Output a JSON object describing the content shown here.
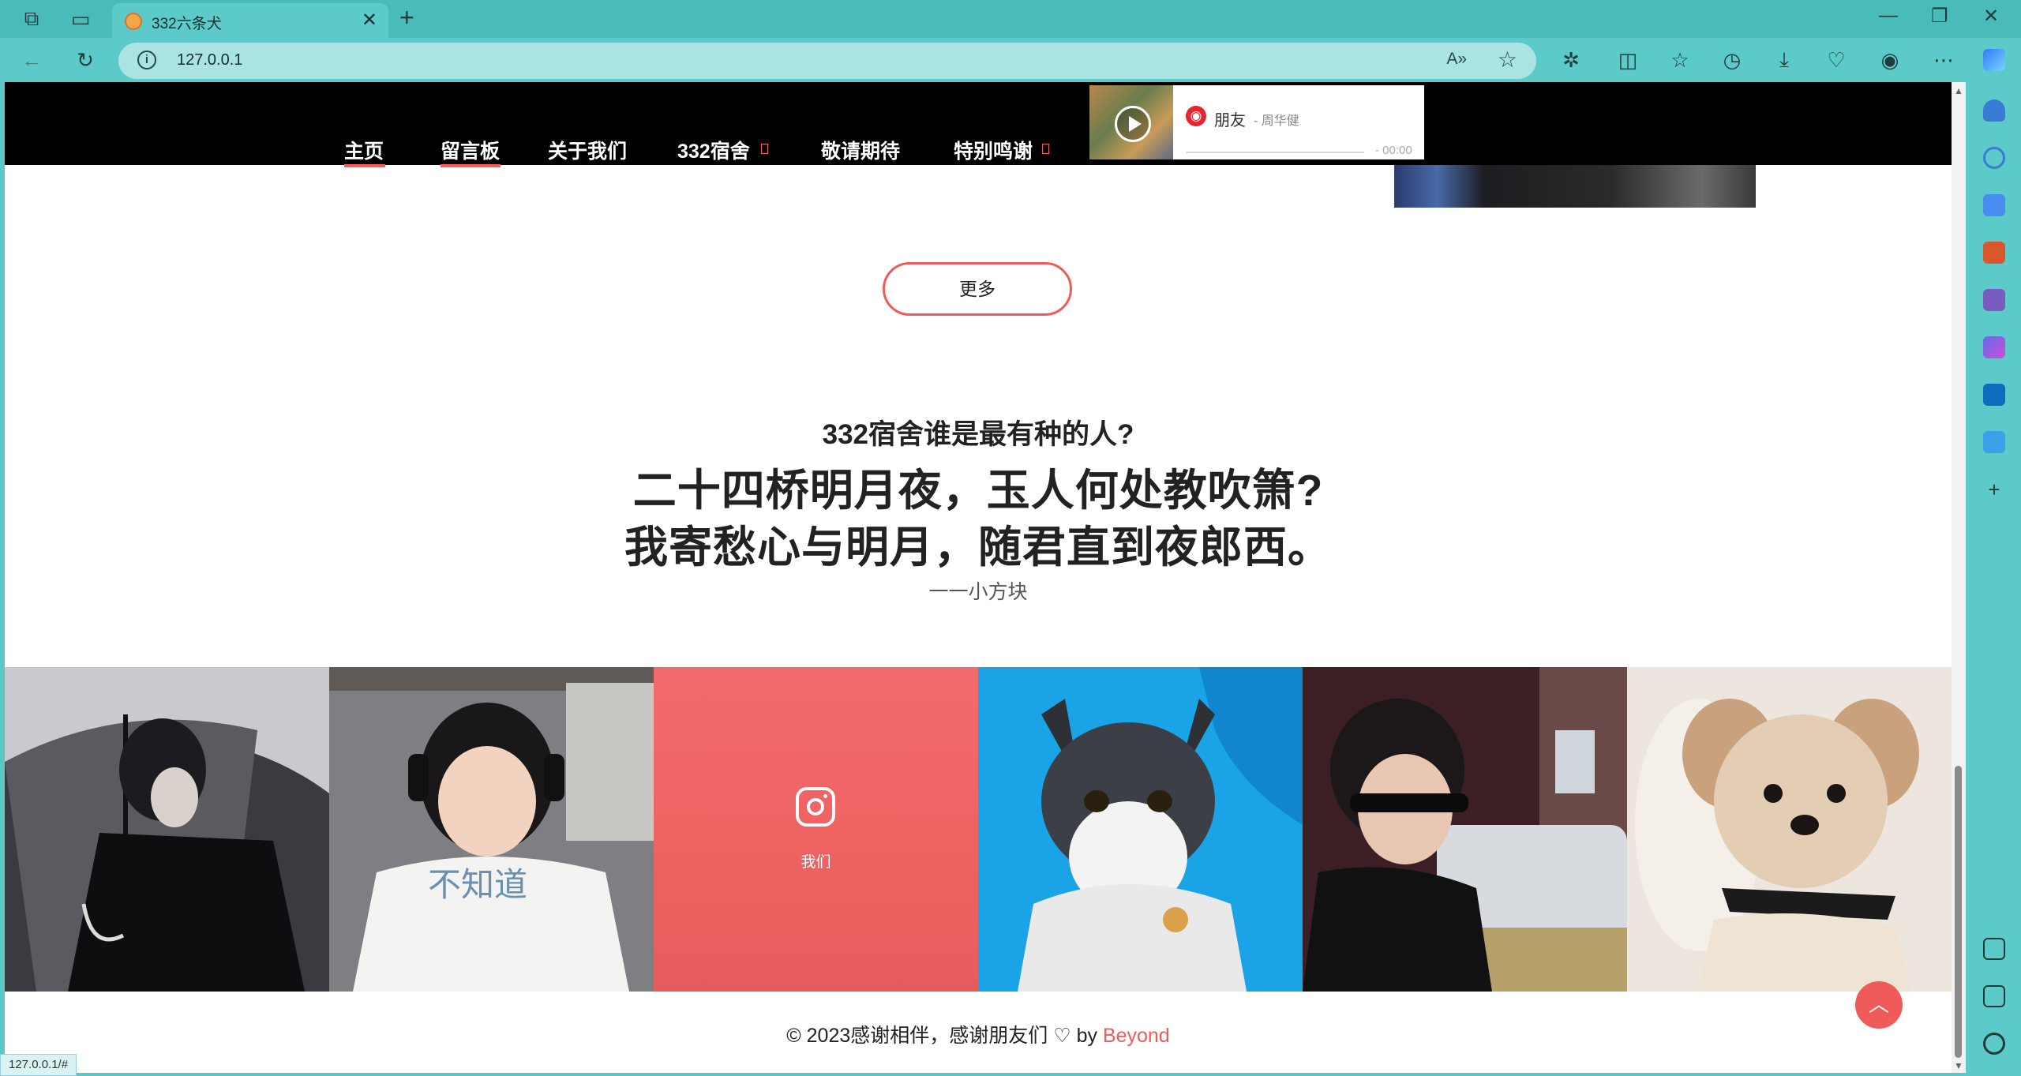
{
  "browser": {
    "tab_title": "332六条犬",
    "url": "127.0.0.1",
    "status_url": "127.0.0.1/#"
  },
  "nav": {
    "items": [
      {
        "label": "主页"
      },
      {
        "label": "留言板"
      },
      {
        "label": "关于我们"
      },
      {
        "label": "332宿舍"
      },
      {
        "label": "敬请期待"
      },
      {
        "label": "特别鸣谢"
      }
    ]
  },
  "player": {
    "song": "朋友",
    "artist": "- 周华健",
    "time": "- 00:00",
    "logo_glyph": "◉"
  },
  "more_button": "更多",
  "quote": {
    "question": "332宿舍谁是最有种的人?",
    "line1": "二十四桥明月夜，玉人何处教吹箫?",
    "line2": "我寄愁心与明月，随君直到夜郎西。",
    "author": "一一小方块"
  },
  "gallery": {
    "center_label": "我们",
    "tiles": [
      {
        "name": "umbrella-photo"
      },
      {
        "name": "boy-headphones-photo"
      },
      {
        "name": "instagram-tile"
      },
      {
        "name": "cat-photo"
      },
      {
        "name": "sunglasses-photo"
      },
      {
        "name": "dog-photo"
      }
    ]
  },
  "footer": {
    "text": "© 2023感谢相伴，感谢朋友们 ♡ by ",
    "brand": "Beyond"
  },
  "colors": {
    "accent": "#f05a5a",
    "nav_bg": "#000000",
    "browser": "#5ccac8"
  }
}
